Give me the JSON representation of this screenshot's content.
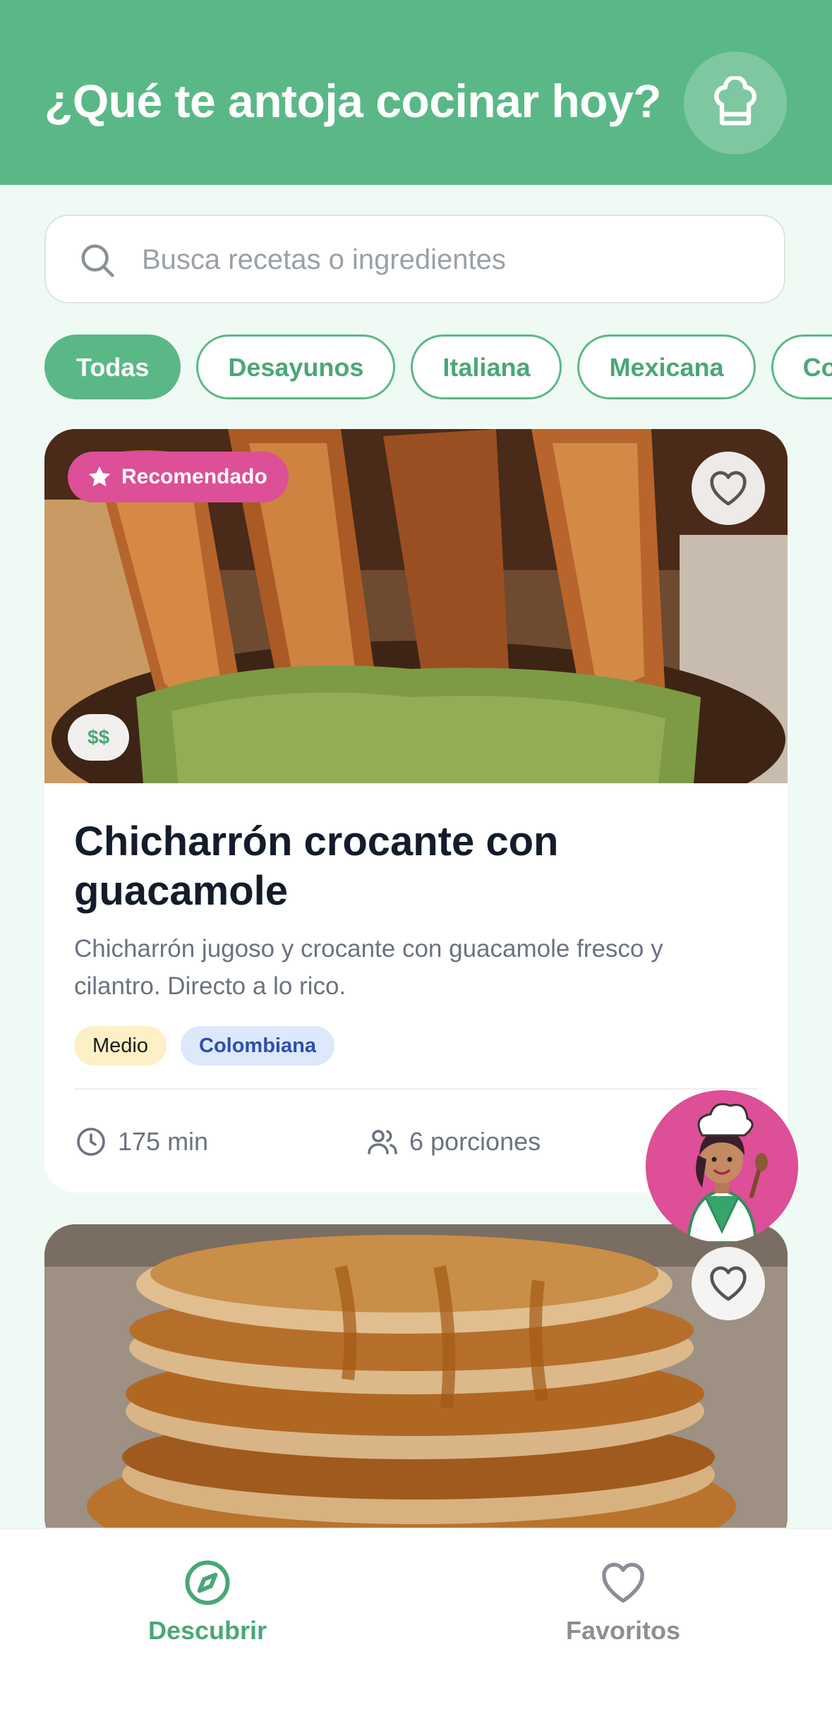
{
  "header": {
    "title": "¿Qué te antoja cocinar hoy?",
    "profile_icon": "chef-hat-icon"
  },
  "search": {
    "placeholder": "Busca recetas o ingredientes",
    "value": ""
  },
  "categories": [
    {
      "label": "Todas",
      "active": true
    },
    {
      "label": "Desayunos",
      "active": false
    },
    {
      "label": "Italiana",
      "active": false
    },
    {
      "label": "Mexicana",
      "active": false
    },
    {
      "label": "Co",
      "active": false
    }
  ],
  "recipes": [
    {
      "badge": "Recomendado",
      "price": "$$",
      "title": "Chicharrón crocante con guacamole",
      "description": "Chicharrón jugoso y crocante con guacamole fresco y cilantro. Directo a lo rico.",
      "difficulty": "Medio",
      "cuisine": "Colombiana",
      "time": "175 min",
      "servings": "6 porciones",
      "favorite": false
    },
    {
      "favorite": false
    }
  ],
  "bottom_nav": [
    {
      "label": "Descubrir",
      "icon": "compass-icon",
      "active": true
    },
    {
      "label": "Favoritos",
      "icon": "heart-icon",
      "active": false
    }
  ],
  "colors": {
    "primary": "#5ab887",
    "badge": "#dd4f96",
    "background": "#f0faf5"
  }
}
